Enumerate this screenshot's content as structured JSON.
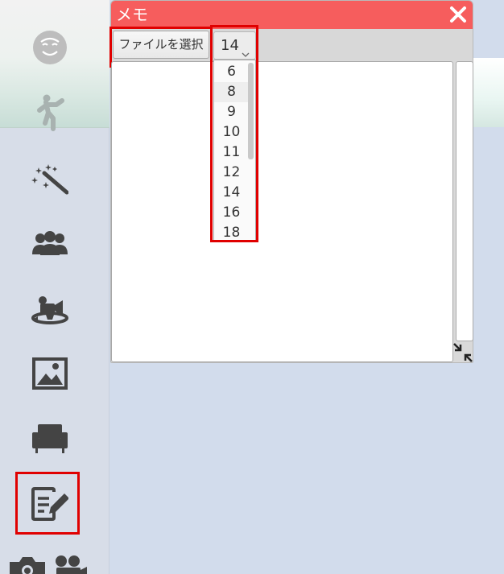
{
  "window": {
    "title": "メモ",
    "file_button_label": "ファイルを選択",
    "font_size_selected": "14",
    "font_size_options": [
      "6",
      "8",
      "9",
      "10",
      "11",
      "12",
      "14",
      "16",
      "18"
    ],
    "hovered_option": "8"
  },
  "sidebar": {
    "items": [
      {
        "icon": "face-icon"
      },
      {
        "icon": "dancer-icon"
      },
      {
        "icon": "magic-wand-icon"
      },
      {
        "icon": "group-icon"
      },
      {
        "icon": "360-camera-icon"
      },
      {
        "icon": "image-icon"
      },
      {
        "icon": "sofa-icon"
      },
      {
        "icon": "note-edit-icon",
        "active": true
      },
      {
        "icon": "camera-icon"
      },
      {
        "icon": "video-camera-icon"
      }
    ]
  },
  "colors": {
    "title_bar": "#f65d5d",
    "highlight": "#e00000",
    "sidebar_bg": "#d7dde8",
    "workspace_bg": "#d2dcec"
  }
}
